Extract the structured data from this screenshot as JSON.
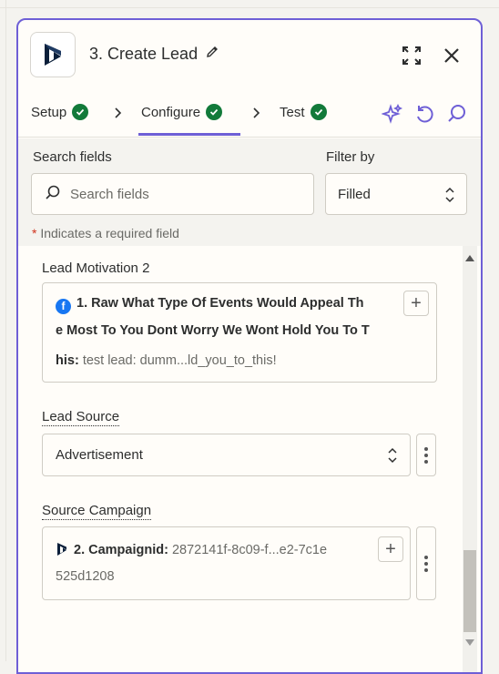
{
  "header": {
    "title": "3. Create Lead",
    "app_icon": "dynamics-logo-icon",
    "edit_icon": "pencil-icon",
    "expand_icon": "expand-icon",
    "close_icon": "close-icon"
  },
  "tabs": [
    {
      "label": "Setup",
      "status": "complete"
    },
    {
      "label": "Configure",
      "status": "complete",
      "active": true
    },
    {
      "label": "Test",
      "status": "complete"
    }
  ],
  "tools": [
    "ai-sparkle-icon",
    "undo-icon",
    "search-icon"
  ],
  "search": {
    "label": "Search fields",
    "placeholder": "Search fields",
    "filter_label": "Filter by",
    "filter_value": "Filled"
  },
  "required_note": {
    "star": "*",
    "text": "Indicates a required field"
  },
  "fields": {
    "lead_motivation": {
      "label": "Lead Motivation 2",
      "pill_line1": "1. Raw What Type Of Events Would Appeal Th",
      "pill_line2": "e Most To You Dont Worry We Wont Hold You To T",
      "pill_line3": "his:",
      "pill_value": "test lead: dumm...ld_you_to_this!"
    },
    "lead_source": {
      "label": "Lead Source",
      "value": "Advertisement"
    },
    "source_campaign": {
      "label": "Source Campaign",
      "pill_label": "2. Campaignid:",
      "pill_value": "2872141f-8c09-f...e2-7c1e",
      "pill_value_cont": "525d1208"
    }
  },
  "colors": {
    "accent": "#6e5fd6",
    "success": "#127a3a",
    "facebook": "#1877f2"
  }
}
